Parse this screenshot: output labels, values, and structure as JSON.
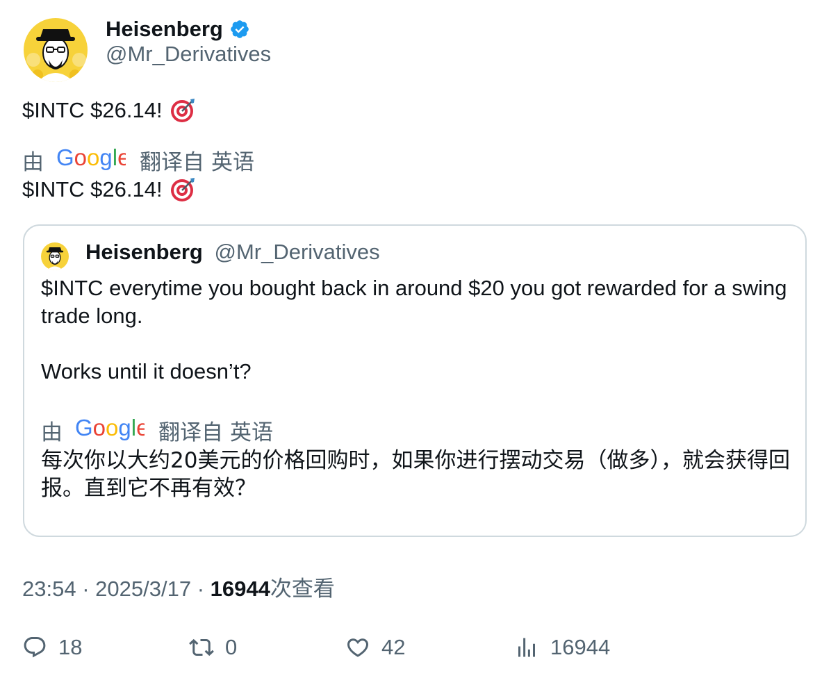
{
  "author": {
    "name": "Heisenberg",
    "handle": "@Mr_Derivatives",
    "verified_color": "#1d9bf0",
    "avatar_icon": "heisenberg-avatar"
  },
  "tweet": {
    "text": "$INTC $26.14!",
    "emoji": "direct-hit-target",
    "translation": {
      "by_label": "由",
      "provider": "Google",
      "translated_from": "翻译自",
      "language": "英语",
      "text": "$INTC $26.14!"
    }
  },
  "quoted": {
    "name": "Heisenberg",
    "handle": "@Mr_Derivatives",
    "paragraph1": "$INTC everytime you bought back in around $20 you got rewarded for a swing trade long.",
    "paragraph2": "Works until it doesn’t?",
    "translation": {
      "by_label": "由",
      "provider": "Google",
      "translated_from": "翻译自",
      "language": "英语",
      "text": "每次你以大约20美元的价格回购时，如果你进行摆动交易（做多），就会获得回报。直到它不再有效？"
    }
  },
  "meta": {
    "time": "23:54",
    "separator": "·",
    "date": "2025/3/17",
    "views_count": "16944",
    "views_label": "次查看"
  },
  "actions": {
    "replies": "18",
    "retweets": "0",
    "likes": "42",
    "views": "16944"
  },
  "colors": {
    "text_primary": "#0f1419",
    "text_secondary": "#536471",
    "border": "#cfd9de",
    "google_blue": "#4285F4",
    "google_red": "#EA4335",
    "google_yellow": "#FBBC05",
    "google_green": "#34A853"
  }
}
